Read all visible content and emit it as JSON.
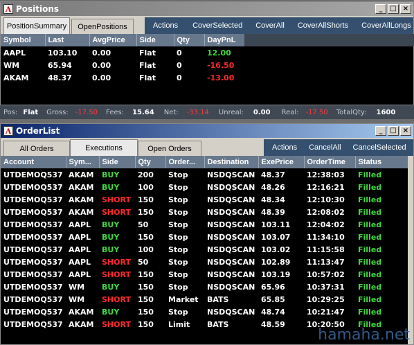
{
  "positions_window": {
    "title": "Positions",
    "tabs": [
      "PositionSummary",
      "OpenPositions"
    ],
    "actions": [
      "Actions",
      "CoverSelected",
      "CoverAll",
      "CoverAllShorts",
      "CoverAllLongs"
    ],
    "columns": [
      "Symbol",
      "Last",
      "AvgPrice",
      "Side",
      "Qty",
      "DayPnL"
    ],
    "rows": [
      {
        "symbol": "AAPL",
        "last": "103.10",
        "avg": "0.00",
        "side": "Flat",
        "qty": "0",
        "pnl": "12.00",
        "pnl_color": "green"
      },
      {
        "symbol": "WM",
        "last": "65.94",
        "avg": "0.00",
        "side": "Flat",
        "qty": "0",
        "pnl": "-16.50",
        "pnl_color": "red"
      },
      {
        "symbol": "AKAM",
        "last": "48.37",
        "avg": "0.00",
        "side": "Flat",
        "qty": "0",
        "pnl": "-13.00",
        "pnl_color": "red"
      }
    ],
    "status": {
      "pos_label": "Pos:",
      "pos": "Flat",
      "gross_label": "Gross:",
      "gross": "-17.50",
      "fees_label": "Fees:",
      "fees": "15.64",
      "net_label": "Net:",
      "net": "-33.14",
      "unreal_label": "Unreal:",
      "unreal": "0.00",
      "real_label": "Real:",
      "real": "-17.50",
      "totalqty_label": "TotalQty:",
      "totalqty": "1600"
    }
  },
  "orders_window": {
    "title": "OrderList",
    "tabs": [
      "All Orders",
      "Executions",
      "Open Orders"
    ],
    "actions": [
      "Actions",
      "CancelAll",
      "CancelSelected"
    ],
    "columns": [
      "Account",
      "Sym...",
      "Side",
      "Qty",
      "Order...",
      "Destination",
      "ExePrice",
      "OrderTime",
      "Status"
    ],
    "rows": [
      {
        "account": "UTDEMOQ537",
        "sym": "AKAM",
        "side": "BUY",
        "qty": "200",
        "type": "Stop",
        "dest": "NSDQSCAN",
        "price": "48.37",
        "time": "12:38:03",
        "status": "Filled"
      },
      {
        "account": "UTDEMOQ537",
        "sym": "AKAM",
        "side": "BUY",
        "qty": "100",
        "type": "Stop",
        "dest": "NSDQSCAN",
        "price": "48.26",
        "time": "12:16:21",
        "status": "Filled"
      },
      {
        "account": "UTDEMOQ537",
        "sym": "AKAM",
        "side": "SHORT",
        "qty": "150",
        "type": "Stop",
        "dest": "NSDQSCAN",
        "price": "48.34",
        "time": "12:10:30",
        "status": "Filled"
      },
      {
        "account": "UTDEMOQ537",
        "sym": "AKAM",
        "side": "SHORT",
        "qty": "150",
        "type": "Stop",
        "dest": "NSDQSCAN",
        "price": "48.39",
        "time": "12:08:02",
        "status": "Filled"
      },
      {
        "account": "UTDEMOQ537",
        "sym": "AAPL",
        "side": "BUY",
        "qty": "50",
        "type": "Stop",
        "dest": "NSDQSCAN",
        "price": "103.11",
        "time": "12:04:02",
        "status": "Filled"
      },
      {
        "account": "UTDEMOQ537",
        "sym": "AAPL",
        "side": "BUY",
        "qty": "150",
        "type": "Stop",
        "dest": "NSDQSCAN",
        "price": "103.07",
        "time": "11:34:10",
        "status": "Filled"
      },
      {
        "account": "UTDEMOQ537",
        "sym": "AAPL",
        "side": "BUY",
        "qty": "100",
        "type": "Stop",
        "dest": "NSDQSCAN",
        "price": "103.02",
        "time": "11:15:58",
        "status": "Filled"
      },
      {
        "account": "UTDEMOQ537",
        "sym": "AAPL",
        "side": "SHORT",
        "qty": "50",
        "type": "Stop",
        "dest": "NSDQSCAN",
        "price": "102.89",
        "time": "11:13:47",
        "status": "Filled"
      },
      {
        "account": "UTDEMOQ537",
        "sym": "AAPL",
        "side": "SHORT",
        "qty": "150",
        "type": "Stop",
        "dest": "NSDQSCAN",
        "price": "103.19",
        "time": "10:57:02",
        "status": "Filled"
      },
      {
        "account": "UTDEMOQ537",
        "sym": "WM",
        "side": "BUY",
        "qty": "150",
        "type": "Stop",
        "dest": "NSDQSCAN",
        "price": "65.96",
        "time": "10:37:31",
        "status": "Filled"
      },
      {
        "account": "UTDEMOQ537",
        "sym": "WM",
        "side": "SHORT",
        "qty": "150",
        "type": "Market",
        "dest": "BATS",
        "price": "65.85",
        "time": "10:29:25",
        "status": "Filled"
      },
      {
        "account": "UTDEMOQ537",
        "sym": "AKAM",
        "side": "BUY",
        "qty": "150",
        "type": "Stop",
        "dest": "NSDQSCAN",
        "price": "48.74",
        "time": "10:21:47",
        "status": "Filled"
      },
      {
        "account": "UTDEMOQ537",
        "sym": "AKAM",
        "side": "SHORT",
        "qty": "150",
        "type": "Limit",
        "dest": "BATS",
        "price": "48.59",
        "time": "10:20:50",
        "status": "Filled"
      }
    ]
  },
  "watermark": "hamaha.net",
  "colors": {
    "buy": "#3ed93e",
    "short": "#ff2a2a",
    "filled": "#3ed93e",
    "header": "#68788c",
    "actions_bar": "#34506e"
  }
}
